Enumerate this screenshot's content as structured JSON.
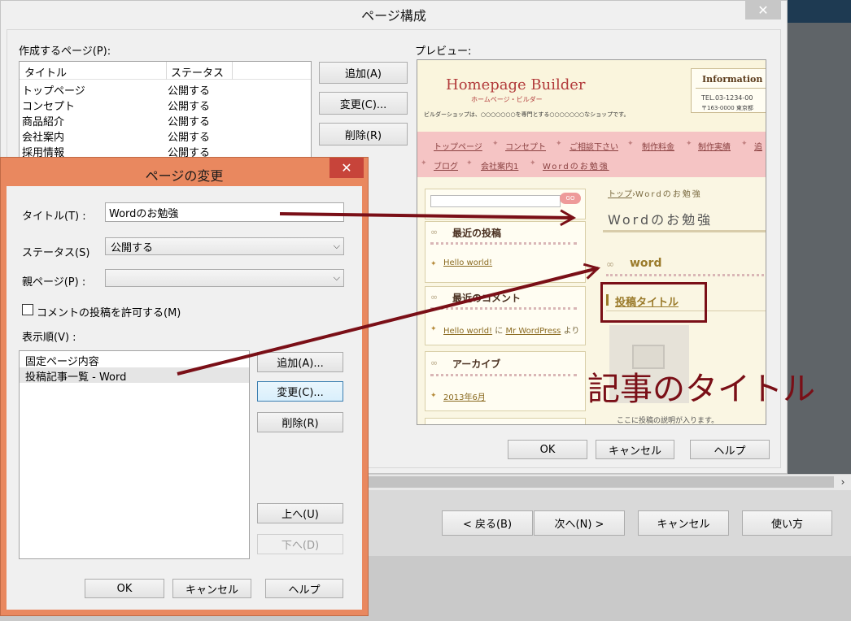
{
  "page_composition": {
    "title": "ページ構成",
    "close_symbol": "✕",
    "pages_label": "作成するページ(P):",
    "columns": [
      "タイトル",
      "ステータス"
    ],
    "rows": [
      {
        "title": "トップページ",
        "status": "公開する"
      },
      {
        "title": "コンセプト",
        "status": "公開する"
      },
      {
        "title": "商品紹介",
        "status": "公開する"
      },
      {
        "title": "会社案内",
        "status": "公開する"
      },
      {
        "title": "採用情報",
        "status": "公開する"
      }
    ],
    "add_label": "追加(A)",
    "change_label": "変更(C)...",
    "delete_label": "削除(R)",
    "preview_label": "プレビュー:",
    "ok_label": "OK",
    "cancel_label": "キャンセル",
    "help_label": "ヘルプ"
  },
  "preview": {
    "logo": "Homepage Builder",
    "logo_sub": "ホームページ・ビルダー",
    "description": "ビルダーショップは、○○○○○○○を専門とする○○○○○○○なショップです。",
    "info_title": "Information",
    "tel": "TEL.03-1234-00",
    "address": "〒163-0000 東京都",
    "nav_row1": [
      "トップページ",
      "コンセプト",
      "ご相談下さい",
      "制作料金",
      "制作実績",
      "追"
    ],
    "nav_row2": [
      "ブログ",
      "会社案内1",
      "Wordのお勉強"
    ],
    "search_go": "GO",
    "recent_posts_title": "最近の投稿",
    "recent_posts_link": "Hello world!",
    "recent_comments_title": "最近のコメント",
    "comment_link1": "Hello world!",
    "comment_mid": "に",
    "comment_link2": "Mr WordPress",
    "comment_tail": "より",
    "archive_title": "アーカイブ",
    "archive_link": "2013年6月",
    "breadcrumb_top": "トップ",
    "breadcrumb_current": "Wordのお勉強",
    "page_title": "Wordのお勉強",
    "category": "word",
    "post_title": "投稿タイトル",
    "post_description": "ここに投稿の説明が入ります。"
  },
  "annotation": "記事のタイトル",
  "wizard": {
    "back_label": "< 戻る(B)",
    "next_label": "次へ(N) >",
    "cancel_label": "キャンセル",
    "usage_label": "使い方",
    "scroll_arrow": "›"
  },
  "change_dialog": {
    "title": "ページの変更",
    "close_symbol": "✕",
    "title_label": "タイトル(T) :",
    "title_value": "Wordのお勉強",
    "status_label": "ステータス(S)",
    "status_value": "公開する",
    "parent_label": "親ページ(P) :",
    "parent_value": "",
    "comment_label": "コメントの投稿を許可する(M)",
    "comment_checked": false,
    "order_label": "表示順(V) :",
    "order_items": [
      "固定ページ内容",
      "投稿記事一覧 - Word"
    ],
    "add_label": "追加(A)...",
    "change_label": "変更(C)...",
    "delete_label": "削除(R)",
    "up_label": "上へ(U)",
    "down_label": "下へ(D)",
    "ok_label": "OK",
    "cancel_label": "キャンセル",
    "help_label": "ヘルプ"
  },
  "colors": {
    "dialog_frame": "#e9885f",
    "annotation": "#7a0f17",
    "preview_nav": "#f5c4c4"
  }
}
